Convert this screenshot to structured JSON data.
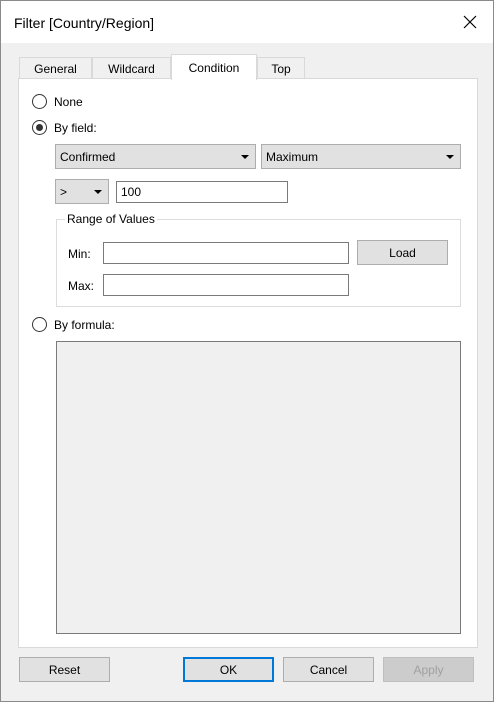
{
  "window": {
    "title": "Filter [Country/Region]"
  },
  "tabs": [
    {
      "label": "General"
    },
    {
      "label": "Wildcard"
    },
    {
      "label": "Condition"
    },
    {
      "label": "Top"
    }
  ],
  "condition": {
    "none_label": "None",
    "by_field_label": "By field:",
    "field_select": "Confirmed",
    "aggregation_select": "Maximum",
    "operator_select": ">",
    "value_input": "100",
    "range": {
      "title": "Range of Values",
      "min_label": "Min:",
      "max_label": "Max:",
      "min_value": "",
      "max_value": "",
      "load_label": "Load"
    },
    "by_formula_label": "By formula:",
    "selected_option": "By field:"
  },
  "footer": {
    "reset_label": "Reset",
    "ok_label": "OK",
    "cancel_label": "Cancel",
    "apply_label": "Apply"
  }
}
